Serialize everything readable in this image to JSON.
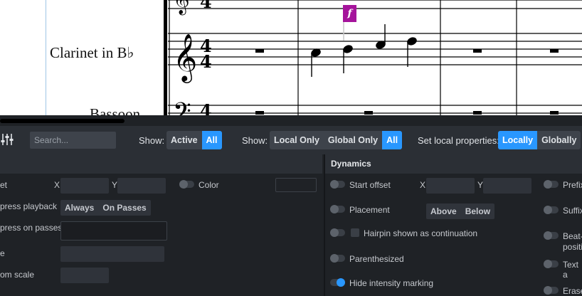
{
  "score": {
    "instrument_names": [
      "Clarinet in B♭",
      "Bassoon"
    ],
    "time_signature": "4/4",
    "dynamic_marking": "f"
  },
  "toolbar": {
    "search_placeholder": "Search...",
    "show_label_1": "Show:",
    "show_options_1": [
      "Active",
      "All"
    ],
    "show_active_1": "All",
    "show_label_2": "Show:",
    "show_options_2": [
      "Local Only",
      "Global Only",
      "All"
    ],
    "show_active_2": "All",
    "local_props_label": "Set local properties:",
    "local_props_options": [
      "Locally",
      "Globally"
    ],
    "local_props_active": "Locally"
  },
  "panel": {
    "left_rows": {
      "offset": "et",
      "offset_x": "X",
      "offset_y": "Y",
      "color": "Color",
      "suppress_playback": "press playback",
      "suppress_options": [
        "Always",
        "On Passes"
      ],
      "suppress_passes": "press on passes",
      "row_e": "e",
      "custom_scale": "om scale"
    },
    "dynamics": {
      "title": "Dynamics",
      "start_offset": "Start offset",
      "x": "X",
      "y": "Y",
      "placement": "Placement",
      "placement_options": [
        "Above",
        "Below"
      ],
      "hairpin_continuation": "Hairpin shown as continuation",
      "parenthesized": "Parenthesized",
      "hide_intensity": "Hide intensity marking",
      "hide_intensity_on": true
    },
    "right_col": {
      "prefix": "Prefix",
      "suffix": "Suffix",
      "beat_1": "Beat-",
      "beat_2": "positi",
      "text_a": "Text a",
      "erase": "Erase"
    }
  },
  "colors": {
    "accent": "#2997ff",
    "dynamic_marker": "#a5149b",
    "panel_bg": "#1f2226",
    "toolbar_bg": "#2b2f35"
  }
}
